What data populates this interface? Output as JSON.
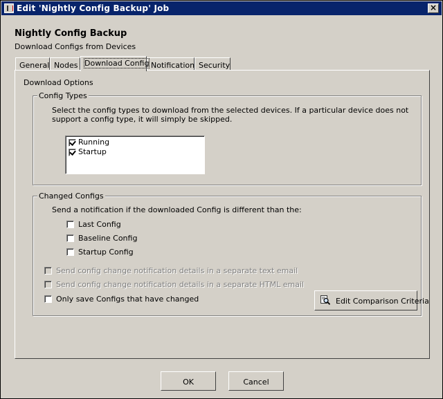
{
  "window": {
    "title": "Edit 'Nightly Config Backup' Job",
    "close_glyph": "×"
  },
  "header": {
    "title": "Nightly Config Backup",
    "subtitle": "Download Configs from Devices"
  },
  "tabs": [
    {
      "label": "General",
      "active": false
    },
    {
      "label": "Nodes",
      "active": false
    },
    {
      "label": "Download Config",
      "active": true
    },
    {
      "label": "Notifications",
      "active": false
    },
    {
      "label": "Security",
      "active": false
    }
  ],
  "download_options": {
    "title": "Download Options",
    "config_types": {
      "label": "Config Types",
      "description_line1": "Select the config types to download from the selected devices.  If a particular device does not",
      "description_line2": "support a config type, it will simply be skipped.",
      "items": [
        {
          "label": "Running",
          "checked": true
        },
        {
          "label": "Startup",
          "checked": true
        }
      ]
    },
    "changed_configs": {
      "label": "Changed Configs",
      "description": "Send a notification if the downloaded Config is different than the:",
      "options": [
        {
          "label": "Last Config",
          "checked": false
        },
        {
          "label": "Baseline Config",
          "checked": false
        },
        {
          "label": "Startup Config",
          "checked": false
        }
      ],
      "send_text_email": {
        "label": "Send config change notification details in a separate text email",
        "checked": false,
        "disabled": true
      },
      "send_html_email": {
        "label": "Send config change notification details in a separate HTML email",
        "checked": false,
        "disabled": true
      },
      "only_save_changed": {
        "label": "Only save Configs that have changed",
        "checked": false
      },
      "edit_criteria_button": "Edit Comparison Criteria"
    }
  },
  "footer": {
    "ok_label": "OK",
    "cancel_label": "Cancel"
  }
}
